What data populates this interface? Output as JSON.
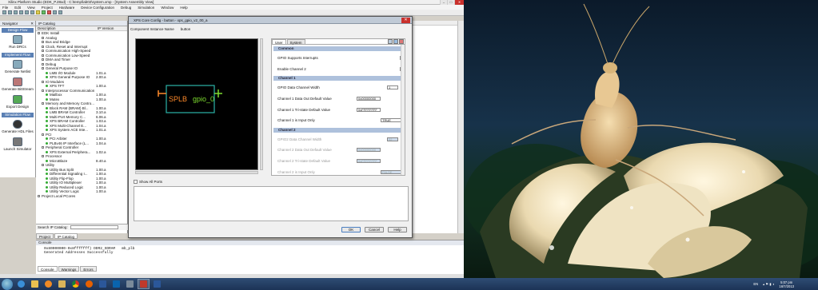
{
  "app": {
    "title": "Xilinx Platform Studio (EDK_P.28xd) - C:\\temp\\lab02\\system.xmp - [System Assembly View]",
    "menu": [
      "File",
      "Edit",
      "View",
      "Project",
      "Hardware",
      "Device Configuration",
      "Debug",
      "Simulation",
      "Window",
      "Help"
    ]
  },
  "navigator": {
    "header": "Navigator",
    "design_flow": "Design Flow",
    "implement_flow": "Implement Flow",
    "simulation_flow": "Simulation Flow",
    "items": {
      "run_drcs": "Run DRCs",
      "generate_netlist": "Generate Netlist",
      "generate_bitstream": "Generate BitStream",
      "export_design": "Export Design",
      "generate_hdl_files": "Generate HDL Files",
      "launch_simulator": "Launch Simulator"
    }
  },
  "catalog": {
    "header": "IP Catalog",
    "columns": [
      "Description",
      "IP Version"
    ],
    "rows": [
      {
        "name": "EDK Install",
        "version": "",
        "level": 0,
        "folder": true
      },
      {
        "name": "Analog",
        "version": "",
        "level": 1,
        "folder": true
      },
      {
        "name": "Bus and Bridge",
        "version": "",
        "level": 1,
        "folder": true
      },
      {
        "name": "Clock, Reset and Interrupt",
        "version": "",
        "level": 1,
        "folder": true
      },
      {
        "name": "Communication High-Speed",
        "version": "",
        "level": 1,
        "folder": true
      },
      {
        "name": "Communication Low-Speed",
        "version": "",
        "level": 1,
        "folder": true
      },
      {
        "name": "DMA and Timer",
        "version": "",
        "level": 1,
        "folder": true
      },
      {
        "name": "Debug",
        "version": "",
        "level": 1,
        "folder": true
      },
      {
        "name": "General Purpose IO",
        "version": "",
        "level": 1,
        "folder": true
      },
      {
        "name": "LMB I/O Module",
        "version": "1.01.a",
        "level": 2,
        "folder": false
      },
      {
        "name": "XPS General Purpose IO",
        "version": "2.00.a",
        "level": 2,
        "folder": false
      },
      {
        "name": "IO Modules",
        "version": "",
        "level": 1,
        "folder": true
      },
      {
        "name": "XPS TFT",
        "version": "1.00.a",
        "level": 2,
        "folder": false
      },
      {
        "name": "Interprocessor Communication",
        "version": "",
        "level": 1,
        "folder": true
      },
      {
        "name": "Mailbox",
        "version": "1.00.a",
        "level": 2,
        "folder": false
      },
      {
        "name": "Mutex",
        "version": "1.00.a",
        "level": 2,
        "folder": false
      },
      {
        "name": "Memory and Memory Contro...",
        "version": "",
        "level": 1,
        "folder": true
      },
      {
        "name": "Block RAM (BRAM) Bl...",
        "version": "1.00.a",
        "level": 2,
        "folder": false
      },
      {
        "name": "LMB BRAM Controller",
        "version": "3.10.a",
        "level": 2,
        "folder": false
      },
      {
        "name": "Multi-Port Memory C...",
        "version": "6.06.a",
        "level": 2,
        "folder": false
      },
      {
        "name": "XPS BRAM Controller",
        "version": "1.03.a",
        "level": 2,
        "folder": false
      },
      {
        "name": "XPS Multi-Channel E...",
        "version": "1.04.a",
        "level": 2,
        "folder": false
      },
      {
        "name": "XPS System ACE Inte...",
        "version": "1.01.a",
        "level": 2,
        "folder": false
      },
      {
        "name": "PCI",
        "version": "",
        "level": 1,
        "folder": true
      },
      {
        "name": "PCI Arbiter",
        "version": "1.00.a",
        "level": 2,
        "folder": false
      },
      {
        "name": "PLBv46 IP Interface (L...",
        "version": "1.04.a",
        "level": 2,
        "folder": false
      },
      {
        "name": "Peripheral Controller",
        "version": "",
        "level": 1,
        "folder": true
      },
      {
        "name": "XPS External Periphera...",
        "version": "1.02.a",
        "level": 2,
        "folder": false
      },
      {
        "name": "Processor",
        "version": "",
        "level": 1,
        "folder": true
      },
      {
        "name": "MicroBlaze",
        "version": "8.40.a",
        "level": 2,
        "folder": false
      },
      {
        "name": "Utility",
        "version": "",
        "level": 1,
        "folder": true
      },
      {
        "name": "Utility Bus Split",
        "version": "1.00.a",
        "level": 2,
        "folder": false
      },
      {
        "name": "Differential Signaling I...",
        "version": "1.00.a",
        "level": 2,
        "folder": false
      },
      {
        "name": "Utility Flip-Flop",
        "version": "1.00.a",
        "level": 2,
        "folder": false
      },
      {
        "name": "Utility IO Multiplexer",
        "version": "1.00.a",
        "level": 2,
        "folder": false
      },
      {
        "name": "Utility Reduced Logic",
        "version": "1.00.a",
        "level": 2,
        "folder": false
      },
      {
        "name": "Utility Vector Logic",
        "version": "1.00.a",
        "level": 2,
        "folder": false
      },
      {
        "name": "Project Local PCores",
        "version": "",
        "level": 0,
        "folder": true
      }
    ],
    "search_label": "Search IP Catalog:",
    "tabs": [
      "Project",
      "IP Catalog"
    ]
  },
  "console": {
    "header": "Console",
    "lines": [
      "0x80000000-0x8fffffff) DDR2_SDRAM   mb_plb",
      "Generated Addresses Successfully"
    ],
    "tabs": [
      "Console",
      "Warnings",
      "Errors"
    ]
  },
  "dialog": {
    "title": "XPS Core Config - button - xps_gpio_v2_00_a",
    "component_label": "Component Instance Name",
    "component_value": "button",
    "block": {
      "bus": "SPLB",
      "name": "gpio_0"
    },
    "show_all_ports": "Show All Ports",
    "tabs": [
      "User",
      "System"
    ],
    "sections": {
      "common": "Common",
      "channel1": "Channel 1",
      "channel2": "Channel 2"
    },
    "params": {
      "gpio_interrupt": "GPIO Supports Interrupts",
      "enable_ch2": "Enable Channel 2",
      "data_width_label": "GPIO Data Channel Width",
      "data_width_value": "1",
      "ch1_dout_label": "Channel 1 Data Out Default Value",
      "ch1_dout_value": "0x00000000",
      "ch1_tri_label": "Channel 1 Tri-state Default Value",
      "ch1_tri_value": "0xFFFFFFFF",
      "ch1_input_label": "Channel 1 is Input Only",
      "ch1_input_value": "TRUE",
      "ch2_width_label": "GPIO2 Data Channel Width",
      "ch2_width_value": "32",
      "ch2_dout_label": "Channel 2 Data Out Default Value",
      "ch2_dout_value": "0x00000000",
      "ch2_tri_label": "Channel 2 Tri-state Default Value",
      "ch2_tri_value": "0xFFFFFFFF",
      "ch2_input_label": "Channel 2 is Input Only",
      "ch2_input_value": "FALSE"
    },
    "buttons": {
      "ok": "OK",
      "cancel": "Cancel",
      "help": "Help"
    }
  },
  "taskbar": {
    "language": "EN",
    "time": "5:07 pm",
    "date": "16/7/2013",
    "apps": [
      "ie",
      "folder",
      "media-player",
      "folder-2",
      "chrome",
      "firefox",
      "word",
      "outlook",
      "calculator",
      "xilinx",
      "word-2"
    ]
  },
  "colors": {
    "block_stroke": "#2bb3a8",
    "splb": "#ff8a2a",
    "gpio": "#7ddc2f",
    "section": "#aec1dc",
    "taskbar": "#1c3356"
  }
}
